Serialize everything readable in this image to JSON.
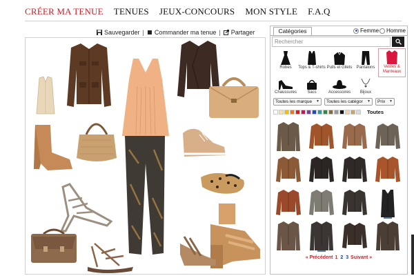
{
  "nav": {
    "items": [
      "CRÉER MA TENUE",
      "TENUES",
      "JEUX-CONCOURS",
      "MON STYLE",
      "F.A.Q"
    ],
    "active_index": 0
  },
  "toolbar": {
    "save_label": "Sauvegarder",
    "order_label": "Commander ma tenue",
    "share_label": "Partager",
    "separator": "|"
  },
  "canvas_items": [
    "vest",
    "leather-jacket",
    "military-jacket",
    "peach-top",
    "handbag-tan",
    "ankle-boot",
    "hobo-bag",
    "leggings",
    "sneaker-gold",
    "leopard-flat",
    "strappy-heel",
    "platform-sandal",
    "satchel-brown",
    "flat-sandal",
    "wedge-sandal"
  ],
  "panel": {
    "tab_label": "Catégories",
    "gender": {
      "female_label": "Femme",
      "male_label": "Homme",
      "selected": "Femme"
    },
    "search_placeholder": "Rechercher",
    "categories": [
      {
        "label": "Robes",
        "icon": "dress-icon"
      },
      {
        "label": "Tops & T-shirts",
        "icon": "tank-top-icon"
      },
      {
        "label": "Pulls et Gilets",
        "icon": "sweater-icon"
      },
      {
        "label": "Pantalons",
        "icon": "pants-icon"
      },
      {
        "label": "Vestes & Manteaux",
        "icon": "jacket-icon",
        "selected": true
      },
      {
        "label": "Chaussures",
        "icon": "heel-shoe-icon"
      },
      {
        "label": "Sacs",
        "icon": "bag-icon"
      },
      {
        "label": "Accessoires",
        "icon": "hat-icon"
      },
      {
        "label": "Bijoux",
        "icon": "necklace-icon"
      }
    ],
    "filters": {
      "brand": "Toutes les marque",
      "category": "Toutes les catégor",
      "price": "Prix"
    },
    "colors": [
      "#ffffff",
      "#f3e3a8",
      "#f2c200",
      "#e07a2b",
      "#d21f1f",
      "#c2185b",
      "#7b3fa0",
      "#1f4fb0",
      "#2c9c9c",
      "#2e8b3d",
      "#8a6a3a",
      "#9a9a9a",
      "#111111",
      "#e8d2b0",
      "#c9a36a",
      "#d9d9d9"
    ],
    "colors_all_label": "Toutes",
    "products": [
      {
        "color": "#6b5a48",
        "kind": "coat"
      },
      {
        "color": "#a0552a",
        "kind": "leather"
      },
      {
        "color": "#9a6a4d",
        "kind": "blazer"
      },
      {
        "color": "#6d6356",
        "kind": "leather"
      },
      {
        "color": "#8c5a36",
        "kind": "leather"
      },
      {
        "color": "#2b2623",
        "kind": "leather"
      },
      {
        "color": "#2f2a27",
        "kind": "leather"
      },
      {
        "color": "#a9552c",
        "kind": "leather"
      },
      {
        "color": "#9a4a2a",
        "kind": "leather"
      },
      {
        "color": "#7d7b72",
        "kind": "hoodie"
      },
      {
        "color": "#3a3430",
        "kind": "leather"
      },
      {
        "color": "#222222",
        "kind": "vest"
      },
      {
        "color": "#6b5546",
        "kind": "coat"
      },
      {
        "color": "#3b3633",
        "kind": "long"
      },
      {
        "color": "#3a2f29",
        "kind": "leather"
      },
      {
        "color": "#4a3e35",
        "kind": "coat"
      }
    ],
    "pager": {
      "prev_label": "« Précédent",
      "pages": [
        "1",
        "2",
        "3"
      ],
      "current": "1",
      "next_label": "Suivant »"
    }
  }
}
